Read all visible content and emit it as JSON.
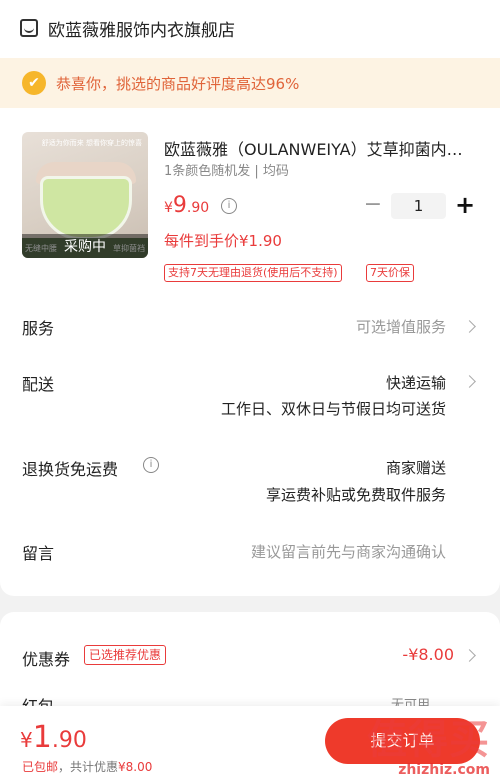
{
  "shop": {
    "name": "欧蓝薇雅服饰内衣旗舰店",
    "icon": "store-icon"
  },
  "banner": {
    "text": "恭喜你，挑选的商品好评度高达96%",
    "icon": "thumbs-up-icon"
  },
  "product": {
    "title": "欧蓝薇雅（OULANWEIYA）艾草抑菌内裤女",
    "spec": "1条颜色随机发 | 均码",
    "image_caption_top": "舒适为你而来 想看你穿上的惊喜",
    "image_strip_left": "无缝中腰",
    "image_strip_right": "草抑菌裆",
    "image_status": "采购中",
    "price_symbol": "¥",
    "price_int": "9",
    "price_dec": ".90",
    "quantity": "1",
    "unit_price": "每件到手价¥1.90",
    "tags": [
      "支持7天无理由退货(使用后不支持)",
      "7天价保"
    ]
  },
  "rows": {
    "service": {
      "label": "服务",
      "value": "可选增值服务"
    },
    "delivery": {
      "label": "配送",
      "value": "快递运输",
      "sub": "工作日、双休日与节假日均可送货"
    },
    "return": {
      "label": "退换货免运费",
      "value": "商家赠送",
      "sub": "享运费补贴或免费取件服务"
    },
    "message": {
      "label": "留言",
      "placeholder": "建议留言前先与商家沟通确认"
    }
  },
  "coupon": {
    "label": "优惠券",
    "badge": "已选推荐优惠",
    "value": "-¥8.00"
  },
  "redpacket": {
    "label": "红包",
    "value": "无可用"
  },
  "bottom": {
    "symbol": "¥",
    "total_int": "1",
    "total_dec": ".90",
    "free_shipping": "已包邮",
    "discount_label": "，共计优惠",
    "discount_value": "¥8.00",
    "submit": "提交订单"
  },
  "watermark": {
    "big": "值得买",
    "small": "zhizhiz.com"
  },
  "colors": {
    "accent": "#e93b3b",
    "banner_bg": "#fdf3e3",
    "banner_text": "#e0643a",
    "submit_bg": "#ee3a2b"
  }
}
